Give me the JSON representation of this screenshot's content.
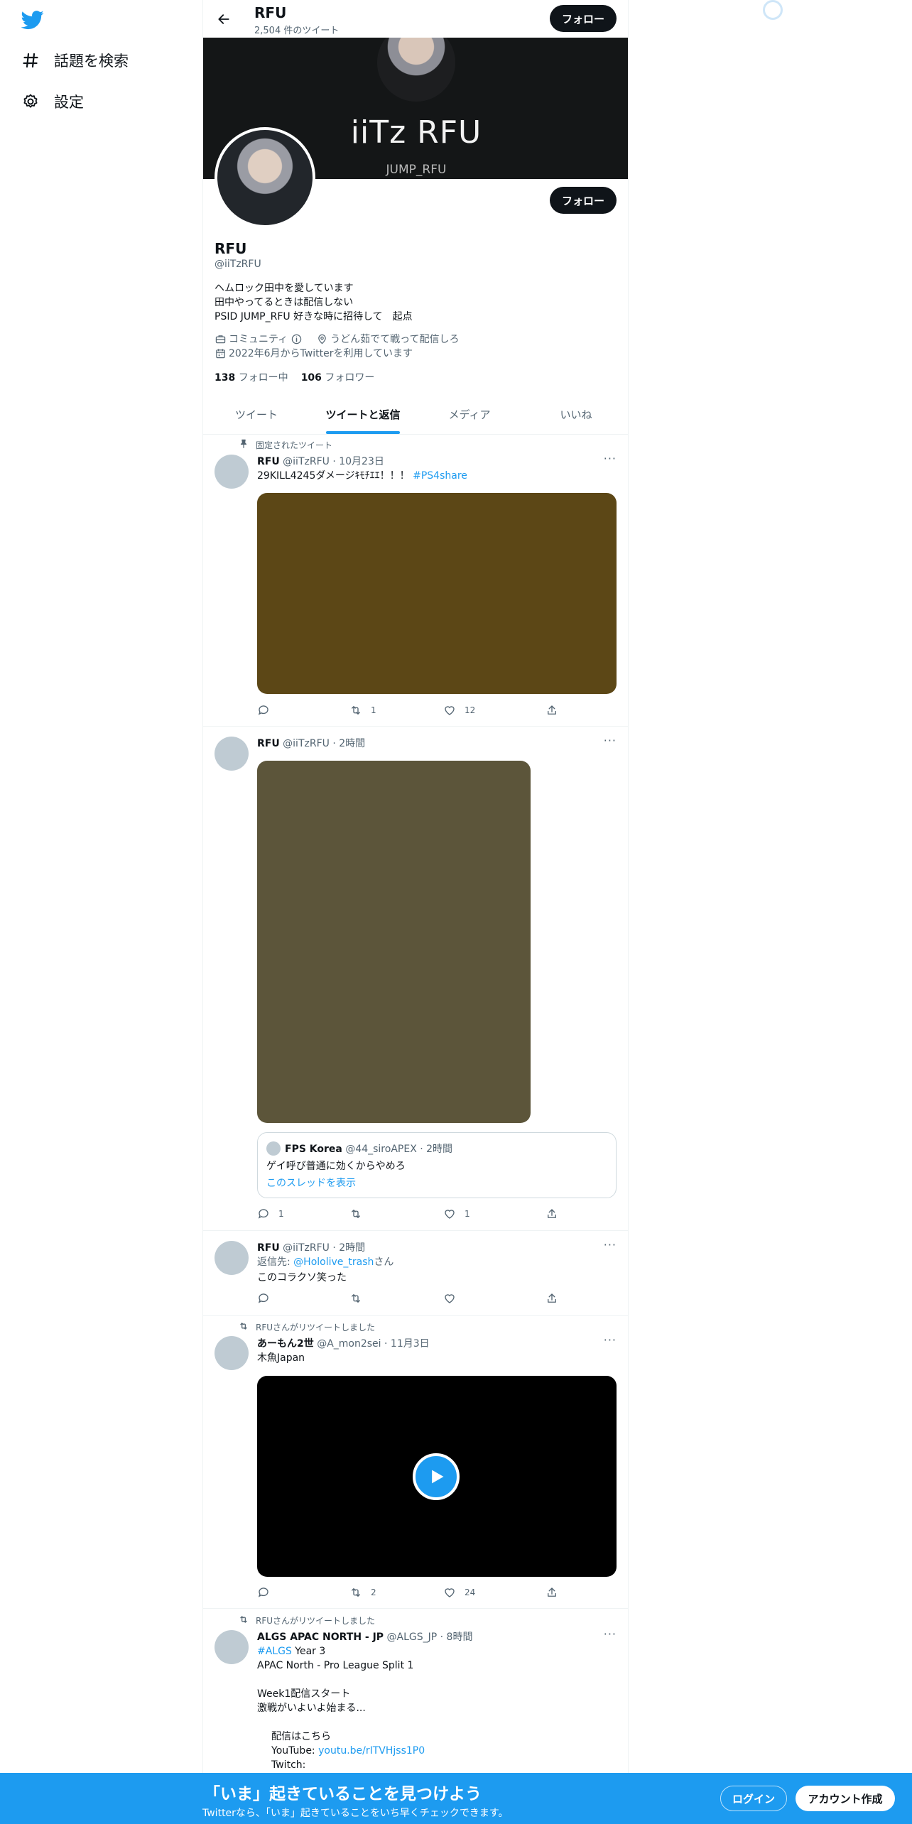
{
  "sidebar": {
    "items": [
      {
        "label": "話題を検索"
      },
      {
        "label": "設定"
      }
    ]
  },
  "header": {
    "name": "RFU",
    "tweet_count": "2,504 件のツイート",
    "follow_label": "フォロー"
  },
  "banner": {
    "title": "iiTz RFU",
    "subtitle": "JUMP_RFU"
  },
  "profile": {
    "follow_label": "フォロー",
    "name": "RFU",
    "handle": "@iiTzRFU",
    "bio": "ヘムロック田中を愛しています\n田中やってるときは配信しない\nPSID JUMP_RFU 好きな時に招待して　起点",
    "category": "コミュニティ",
    "location": "うどん茹でて戦って配信しろ",
    "joined": "2022年6月からTwitterを利用しています",
    "following_count": "138",
    "following_label": "フォロー中",
    "followers_count": "106",
    "followers_label": "フォロワー"
  },
  "tabs": [
    {
      "label": "ツイート"
    },
    {
      "label": "ツイートと返信"
    },
    {
      "label": "メディア"
    },
    {
      "label": "いいね"
    }
  ],
  "tweets": [
    {
      "context": "固定されたツイート",
      "name": "RFU",
      "meta": "@iiTzRFU · 10月23日",
      "text": "29KILL4245ダメージｷﾓﾁｴｴ！！！",
      "hashtag": "#PS4share",
      "media_color": "#5c4716",
      "replies": "",
      "retweets": "1",
      "likes": "12"
    },
    {
      "name": "RFU",
      "meta": "@iiTzRFU · 2時間",
      "media_color": "#5c553a",
      "quote": {
        "name": "FPS Korea",
        "meta": "@44_siroAPEX · 2時間",
        "text": "ゲイ呼び普通に効くからやめろ",
        "thread_link": "このスレッドを表示"
      },
      "replies": "1",
      "retweets": "",
      "likes": "1"
    },
    {
      "name": "RFU",
      "meta": "@iiTzRFU · 2時間",
      "reply_prefix": "返信先: ",
      "reply_to": "@Hololive_trash",
      "reply_suffix": "さん",
      "text": "このコラクソ笑った",
      "replies": "",
      "retweets": "",
      "likes": ""
    },
    {
      "context": "RFUさんがリツイートしました",
      "name": "あーもん2世",
      "meta": "@A_mon2sei · 11月3日",
      "text": "木魚Japan",
      "media_color": "#000000",
      "replies": "",
      "retweets": "2",
      "likes": "24"
    },
    {
      "context": "RFUさんがリツイートしました",
      "name": "ALGS APAC NORTH - JP",
      "meta": "@ALGS_JP · 8時間",
      "hashtag": "#ALGS",
      "text_line1": " Year 3",
      "text_body": "APAC North - Pro League Split 1\n\nWeek1配信スタート\n激戦がいよいよ始まる...",
      "stream_label": "配信はこちら",
      "youtube_label": "YouTube: ",
      "youtube_link": "youtu.be/rITVHjss1P0",
      "twitch_label": "Twitch:"
    }
  ],
  "bottom_bar": {
    "title": "「いま」起きていることを見つけよう",
    "subtitle": "Twitterなら、「いま」起きていることをいち早くチェックできます。",
    "login_label": "ログイン",
    "signup_label": "アカウント作成"
  },
  "colors": {
    "accent": "#1d9bf0",
    "text": "#0f1419",
    "secondary": "#536471"
  }
}
